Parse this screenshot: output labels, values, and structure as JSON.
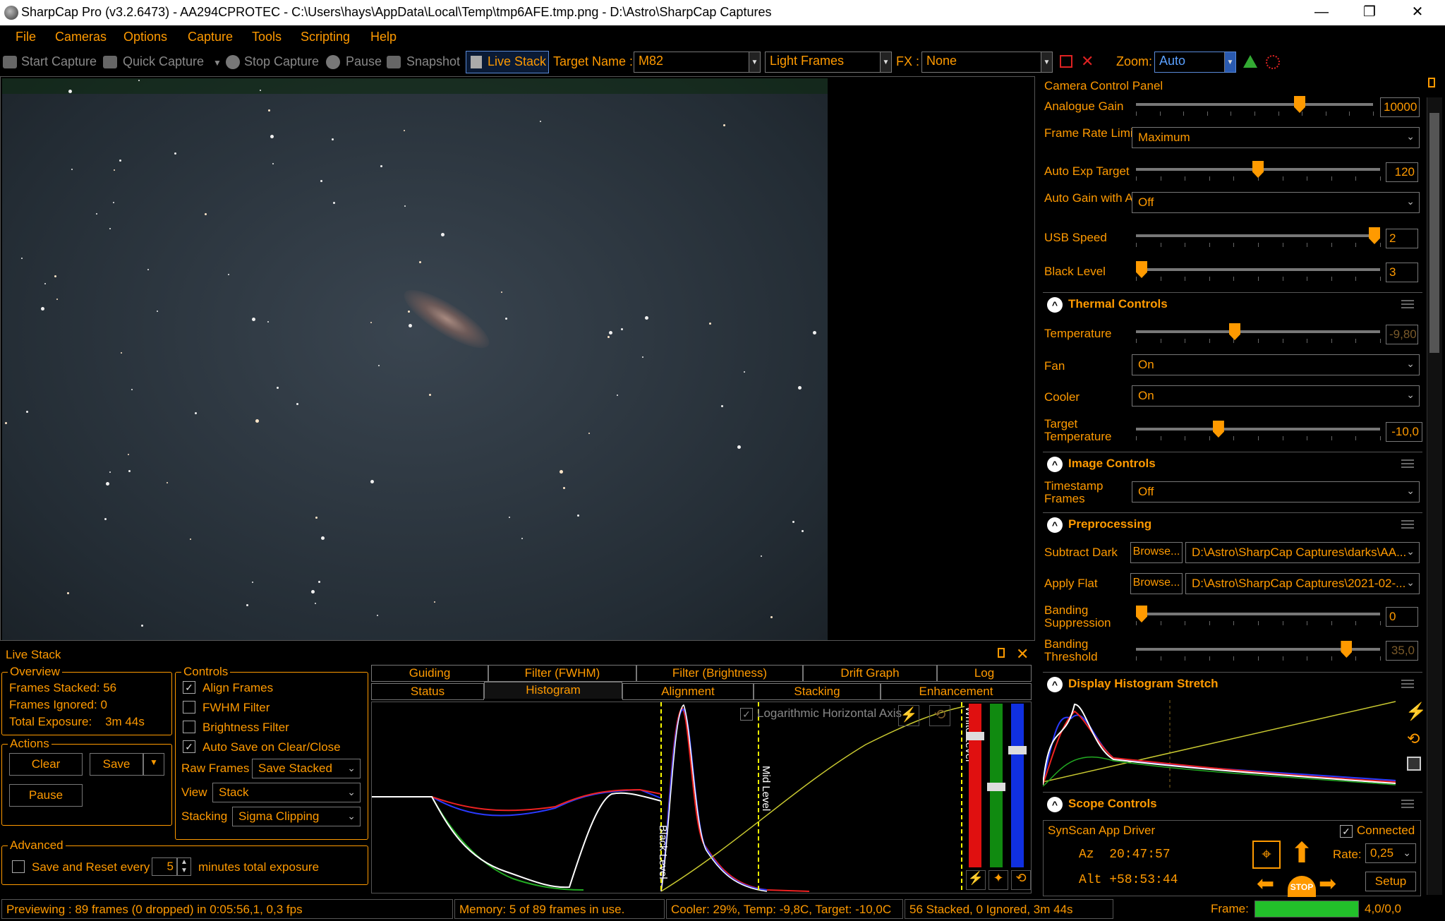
{
  "window": {
    "title": "SharpCap Pro (v3.2.6473) - AA294CPROTEC - C:\\Users\\hays\\AppData\\Local\\Temp\\tmp6AFE.tmp.png - D:\\Astro\\SharpCap Captures",
    "minimize": "—",
    "restore": "❐",
    "close": "✕"
  },
  "menu": [
    "File",
    "Cameras",
    "Options",
    "Capture",
    "Tools",
    "Scripting",
    "Help"
  ],
  "toolbar": {
    "start_capture": "Start Capture",
    "quick_capture": "Quick Capture",
    "stop_capture": "Stop Capture",
    "pause": "Pause",
    "snapshot": "Snapshot",
    "live_stack": "Live Stack",
    "target_name_label": "Target Name :",
    "target_name_value": "M82",
    "frame_type": "Light Frames",
    "fx_label": "FX :",
    "fx_value": "None",
    "zoom_label": "Zoom:",
    "zoom_value": "Auto"
  },
  "camera_panel": {
    "title": "Camera Control Panel",
    "analogue_gain_label": "Analogue Gain",
    "analogue_gain_value": "10000",
    "analogue_gain_level": 0.7,
    "frame_rate_label": "Frame Rate Limit",
    "frame_rate_value": "Maximum",
    "auto_exp_label": "Auto Exp Target",
    "auto_exp_value": "120",
    "auto_exp_level": 0.5,
    "auto_gain_label": "Auto Gain with Auto Exposure",
    "auto_gain_value": "Off",
    "usb_label": "USB Speed",
    "usb_value": "2",
    "usb_level": 1.0,
    "black_label": "Black Level",
    "black_value": "3",
    "black_level": 0.0,
    "thermal": {
      "title": "Thermal Controls",
      "temp_label": "Temperature",
      "temp_value": "-9,80",
      "temp_level": 0.4,
      "fan_label": "Fan",
      "fan_value": "On",
      "cooler_label": "Cooler",
      "cooler_value": "On",
      "target_label": "Target Temperature",
      "target_value": "-10,0",
      "target_level": 0.33
    },
    "image": {
      "title": "Image Controls",
      "timestamp_label": "Timestamp Frames",
      "timestamp_value": "Off"
    },
    "preprocessing": {
      "title": "Preprocessing",
      "dark_label": "Subtract Dark",
      "browse": "Browse...",
      "dark_path": "D:\\Astro\\SharpCap Captures\\darks\\AA...",
      "flat_label": "Apply Flat",
      "flat_path": "D:\\Astro\\SharpCap Captures\\2021-02-...",
      "banding_label": "Banding Suppression",
      "banding_value": "0",
      "banding_level": 0.0,
      "threshold_label": "Banding Threshold",
      "threshold_value": "35,0",
      "threshold_level": 0.88
    },
    "histogram": {
      "title": "Display Histogram Stretch"
    },
    "scope": {
      "title": "Scope Controls",
      "driver": "SynScan App Driver",
      "connected_label": "Connected",
      "az": "Az  20:47:57",
      "alt": "Alt +58:53:44",
      "rate_label": "Rate:",
      "rate_value": "0,25",
      "setup": "Setup",
      "stop": "STOP"
    }
  },
  "live_stack": {
    "title": "Live Stack",
    "overview_label": "Overview",
    "frames_stacked": "Frames Stacked:  56",
    "frames_ignored": "Frames Ignored:  0",
    "total_exposure": "Total Exposure:    3m 44s",
    "actions_label": "Actions",
    "clear": "Clear",
    "save": "Save",
    "pause": "Pause",
    "advanced_label": "Advanced",
    "save_reset": "Save and Reset every",
    "minutes_value": "5",
    "minutes_label": "minutes total exposure",
    "controls_label": "Controls",
    "align_frames": "Align Frames",
    "fwhm_filter": "FWHM Filter",
    "brightness_filter": "Brightness Filter",
    "auto_save": "Auto Save on Clear/Close",
    "raw_frames_label": "Raw Frames",
    "raw_frames_value": "Save Stacked",
    "view_label": "View",
    "view_value": "Stack",
    "stacking_label": "Stacking",
    "stacking_value": "Sigma Clipping",
    "tabs_top": [
      "Guiding",
      "Filter (FWHM)",
      "Filter (Brightness)",
      "Drift Graph",
      "Log"
    ],
    "tabs_bottom": [
      "Status",
      "Histogram",
      "Alignment",
      "Stacking",
      "Enhancement"
    ],
    "log_axis": "Logarithmic Horizontal Axis",
    "black_level_marker": "Black Level",
    "mid_level_marker": "Mid Level",
    "white_level_marker": "White Level"
  },
  "status": {
    "previewing": "Previewing : 89 frames (0 dropped) in 0:05:56,1, 0,3 fps",
    "memory": "Memory: 5 of 89 frames in use.",
    "cooler": "Cooler: 29%, Temp: -9,8C, Target: -10,0C",
    "stacked": "56 Stacked, 0 Ignored, 3m 44s",
    "frame_label": "Frame:",
    "frame_value": "4,0/0,0"
  },
  "colors": {
    "accent": "#ff9a00",
    "green_bar": "#22c02a"
  }
}
